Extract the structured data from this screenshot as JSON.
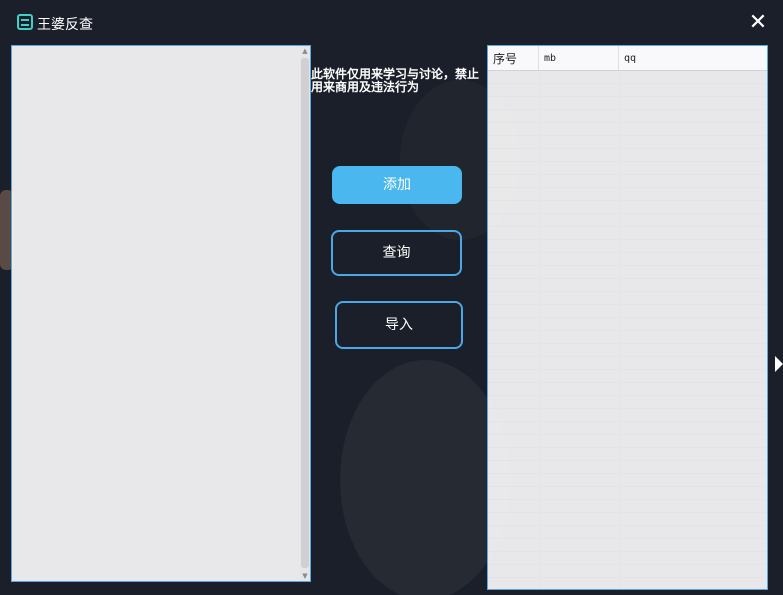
{
  "window": {
    "title": "王婆反查",
    "close_icon": "close-icon",
    "app_icon": "app-logo-icon"
  },
  "notice": {
    "text": "此软件仅用来学习与讨论，禁止用来商用及违法行为"
  },
  "buttons": {
    "add_label": "添加",
    "query_label": "查询",
    "import_label": "导入"
  },
  "table": {
    "columns": [
      "序号",
      "mb",
      "qq"
    ],
    "rows": []
  },
  "colors": {
    "accent": "#4ab8ee",
    "border": "#5aa8e0",
    "window_bg": "#1a1f2a"
  }
}
